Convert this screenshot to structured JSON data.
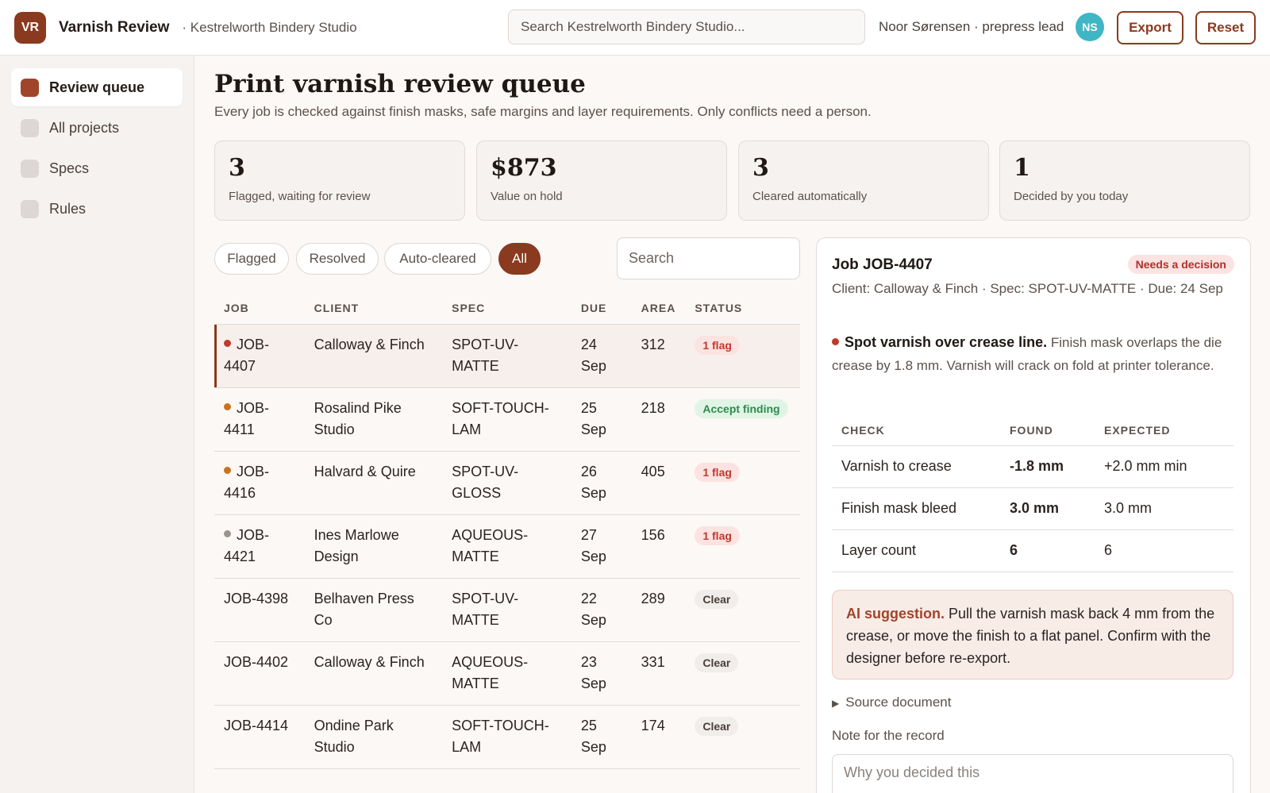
{
  "header": {
    "logo": "VR",
    "app_title": "Varnish Review",
    "org": "· Kestrelworth Bindery Studio",
    "search_placeholder": "Search Kestrelworth Bindery Studio...",
    "user": "Noor Sørensen · prepress lead",
    "avatar": "NS",
    "export_label": "Export",
    "reset_label": "Reset"
  },
  "sidebar": {
    "items": [
      {
        "label": "Review queue",
        "active": true
      },
      {
        "label": "All projects",
        "active": false
      },
      {
        "label": "Specs",
        "active": false
      },
      {
        "label": "Rules",
        "active": false
      }
    ]
  },
  "page": {
    "title": "Print varnish review queue",
    "subtitle": "Every job is checked against finish masks, safe margins and layer requirements. Only conflicts need a person."
  },
  "stats": [
    {
      "value": "3",
      "label": "Flagged, waiting for review"
    },
    {
      "value": "$873",
      "label": "Value on hold"
    },
    {
      "value": "3",
      "label": "Cleared automatically"
    },
    {
      "value": "1",
      "label": "Decided by you today"
    }
  ],
  "filters": [
    "Flagged",
    "Resolved",
    "Auto-cleared",
    "All"
  ],
  "active_filter": "All",
  "list_search_placeholder": "Search",
  "table": {
    "columns": [
      "JOB",
      "CLIENT",
      "SPEC",
      "DUE",
      "AREA",
      "STATUS"
    ],
    "rows": [
      {
        "job": "JOB-4407",
        "client": "Calloway & Finch",
        "spec": "SPOT-UV-MATTE",
        "due": "24 Sep",
        "area": "312",
        "status": "1 flag",
        "status_kind": "red",
        "dot": "#c0392b",
        "selected": true
      },
      {
        "job": "JOB-4411",
        "client": "Rosalind Pike Studio",
        "spec": "SOFT-TOUCH-LAM",
        "due": "25 Sep",
        "area": "218",
        "status": "Accept finding",
        "status_kind": "green",
        "dot": "#c8741e",
        "selected": false
      },
      {
        "job": "JOB-4416",
        "client": "Halvard & Quire",
        "spec": "SPOT-UV-GLOSS",
        "due": "26 Sep",
        "area": "405",
        "status": "1 flag",
        "status_kind": "red",
        "dot": "#c8741e",
        "selected": false
      },
      {
        "job": "JOB-4421",
        "client": "Ines Marlowe Design",
        "spec": "AQUEOUS-MATTE",
        "due": "27 Sep",
        "area": "156",
        "status": "1 flag",
        "status_kind": "red",
        "dot": "#9a948f",
        "selected": false
      },
      {
        "job": "JOB-4398",
        "client": "Belhaven Press Co",
        "spec": "SPOT-UV-MATTE",
        "due": "22 Sep",
        "area": "289",
        "status": "Clear",
        "status_kind": "grey",
        "dot": null,
        "selected": false
      },
      {
        "job": "JOB-4402",
        "client": "Calloway & Finch",
        "spec": "AQUEOUS-MATTE",
        "due": "23 Sep",
        "area": "331",
        "status": "Clear",
        "status_kind": "grey",
        "dot": null,
        "selected": false
      },
      {
        "job": "JOB-4414",
        "client": "Ondine Park Studio",
        "spec": "SOFT-TOUCH-LAM",
        "due": "25 Sep",
        "area": "174",
        "status": "Clear",
        "status_kind": "grey",
        "dot": null,
        "selected": false
      }
    ]
  },
  "detail": {
    "title": "Job JOB-4407",
    "badge": "Needs a decision",
    "meta": "Client: Calloway & Finch · Spec: SPOT-UV-MATTE · Due: 24 Sep",
    "finding_title": "Spot varnish over crease line.",
    "finding_text": "Finish mask overlaps the die crease by 1.8 mm. Varnish will crack on fold at printer tolerance.",
    "finding_dot": "#c0392b",
    "checks_columns": [
      "CHECK",
      "FOUND",
      "EXPECTED"
    ],
    "checks": [
      {
        "check": "Varnish to crease",
        "found": "-1.8 mm",
        "found_kind": "red",
        "expected": "+2.0 mm min"
      },
      {
        "check": "Finish mask bleed",
        "found": "3.0 mm",
        "found_kind": "green",
        "expected": "3.0 mm"
      },
      {
        "check": "Layer count",
        "found": "6",
        "found_kind": "green",
        "expected": "6"
      }
    ],
    "ai_label": "AI suggestion.",
    "ai_text": "Pull the varnish mask back 4 mm from the crease, or move the finish to a flat panel. Confirm with the designer before re-export.",
    "source_label": "Source document",
    "note_label": "Note for the record",
    "note_placeholder": "Why you decided this"
  },
  "colors": {
    "accent": "#8a3a1e",
    "flag_red": "#c0392b",
    "ok_green": "#2e8b4e",
    "avatar": "#3fb6c4"
  }
}
